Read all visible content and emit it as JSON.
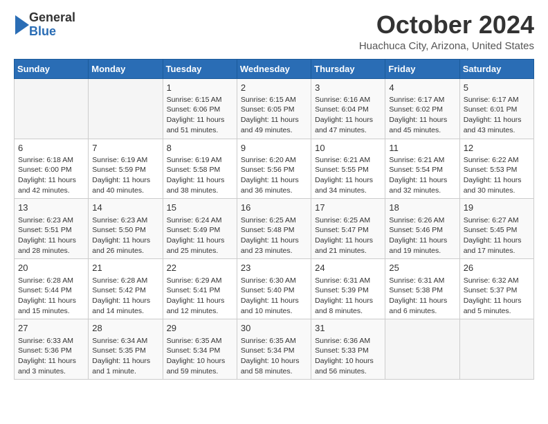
{
  "header": {
    "logo": {
      "line1": "General",
      "line2": "Blue"
    },
    "title": "October 2024",
    "location": "Huachuca City, Arizona, United States"
  },
  "days_of_week": [
    "Sunday",
    "Monday",
    "Tuesday",
    "Wednesday",
    "Thursday",
    "Friday",
    "Saturday"
  ],
  "weeks": [
    [
      {
        "day": "",
        "info": ""
      },
      {
        "day": "",
        "info": ""
      },
      {
        "day": "1",
        "info": "Sunrise: 6:15 AM\nSunset: 6:06 PM\nDaylight: 11 hours and 51 minutes."
      },
      {
        "day": "2",
        "info": "Sunrise: 6:15 AM\nSunset: 6:05 PM\nDaylight: 11 hours and 49 minutes."
      },
      {
        "day": "3",
        "info": "Sunrise: 6:16 AM\nSunset: 6:04 PM\nDaylight: 11 hours and 47 minutes."
      },
      {
        "day": "4",
        "info": "Sunrise: 6:17 AM\nSunset: 6:02 PM\nDaylight: 11 hours and 45 minutes."
      },
      {
        "day": "5",
        "info": "Sunrise: 6:17 AM\nSunset: 6:01 PM\nDaylight: 11 hours and 43 minutes."
      }
    ],
    [
      {
        "day": "6",
        "info": "Sunrise: 6:18 AM\nSunset: 6:00 PM\nDaylight: 11 hours and 42 minutes."
      },
      {
        "day": "7",
        "info": "Sunrise: 6:19 AM\nSunset: 5:59 PM\nDaylight: 11 hours and 40 minutes."
      },
      {
        "day": "8",
        "info": "Sunrise: 6:19 AM\nSunset: 5:58 PM\nDaylight: 11 hours and 38 minutes."
      },
      {
        "day": "9",
        "info": "Sunrise: 6:20 AM\nSunset: 5:56 PM\nDaylight: 11 hours and 36 minutes."
      },
      {
        "day": "10",
        "info": "Sunrise: 6:21 AM\nSunset: 5:55 PM\nDaylight: 11 hours and 34 minutes."
      },
      {
        "day": "11",
        "info": "Sunrise: 6:21 AM\nSunset: 5:54 PM\nDaylight: 11 hours and 32 minutes."
      },
      {
        "day": "12",
        "info": "Sunrise: 6:22 AM\nSunset: 5:53 PM\nDaylight: 11 hours and 30 minutes."
      }
    ],
    [
      {
        "day": "13",
        "info": "Sunrise: 6:23 AM\nSunset: 5:51 PM\nDaylight: 11 hours and 28 minutes."
      },
      {
        "day": "14",
        "info": "Sunrise: 6:23 AM\nSunset: 5:50 PM\nDaylight: 11 hours and 26 minutes."
      },
      {
        "day": "15",
        "info": "Sunrise: 6:24 AM\nSunset: 5:49 PM\nDaylight: 11 hours and 25 minutes."
      },
      {
        "day": "16",
        "info": "Sunrise: 6:25 AM\nSunset: 5:48 PM\nDaylight: 11 hours and 23 minutes."
      },
      {
        "day": "17",
        "info": "Sunrise: 6:25 AM\nSunset: 5:47 PM\nDaylight: 11 hours and 21 minutes."
      },
      {
        "day": "18",
        "info": "Sunrise: 6:26 AM\nSunset: 5:46 PM\nDaylight: 11 hours and 19 minutes."
      },
      {
        "day": "19",
        "info": "Sunrise: 6:27 AM\nSunset: 5:45 PM\nDaylight: 11 hours and 17 minutes."
      }
    ],
    [
      {
        "day": "20",
        "info": "Sunrise: 6:28 AM\nSunset: 5:44 PM\nDaylight: 11 hours and 15 minutes."
      },
      {
        "day": "21",
        "info": "Sunrise: 6:28 AM\nSunset: 5:42 PM\nDaylight: 11 hours and 14 minutes."
      },
      {
        "day": "22",
        "info": "Sunrise: 6:29 AM\nSunset: 5:41 PM\nDaylight: 11 hours and 12 minutes."
      },
      {
        "day": "23",
        "info": "Sunrise: 6:30 AM\nSunset: 5:40 PM\nDaylight: 11 hours and 10 minutes."
      },
      {
        "day": "24",
        "info": "Sunrise: 6:31 AM\nSunset: 5:39 PM\nDaylight: 11 hours and 8 minutes."
      },
      {
        "day": "25",
        "info": "Sunrise: 6:31 AM\nSunset: 5:38 PM\nDaylight: 11 hours and 6 minutes."
      },
      {
        "day": "26",
        "info": "Sunrise: 6:32 AM\nSunset: 5:37 PM\nDaylight: 11 hours and 5 minutes."
      }
    ],
    [
      {
        "day": "27",
        "info": "Sunrise: 6:33 AM\nSunset: 5:36 PM\nDaylight: 11 hours and 3 minutes."
      },
      {
        "day": "28",
        "info": "Sunrise: 6:34 AM\nSunset: 5:35 PM\nDaylight: 11 hours and 1 minute."
      },
      {
        "day": "29",
        "info": "Sunrise: 6:35 AM\nSunset: 5:34 PM\nDaylight: 10 hours and 59 minutes."
      },
      {
        "day": "30",
        "info": "Sunrise: 6:35 AM\nSunset: 5:34 PM\nDaylight: 10 hours and 58 minutes."
      },
      {
        "day": "31",
        "info": "Sunrise: 6:36 AM\nSunset: 5:33 PM\nDaylight: 10 hours and 56 minutes."
      },
      {
        "day": "",
        "info": ""
      },
      {
        "day": "",
        "info": ""
      }
    ]
  ]
}
